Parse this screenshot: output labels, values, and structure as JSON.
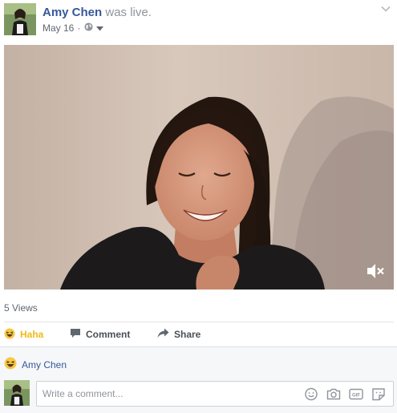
{
  "post": {
    "author": "Amy Chen",
    "action": "was live.",
    "date": "May 16",
    "separator": "·",
    "privacy_icon": "globe-icon",
    "menu_icon": "chevron-down-icon"
  },
  "video": {
    "mute_icon": "speaker-muted-icon"
  },
  "stats": {
    "views": "5 Views"
  },
  "actions": {
    "reaction_label": "Haha",
    "reaction_icon": "haha-emoji-icon",
    "comment_label": "Comment",
    "share_label": "Share"
  },
  "reactions": {
    "icon": "haha-emoji-icon",
    "names": "Amy Chen"
  },
  "comment_box": {
    "placeholder": "Write a comment...",
    "buttons": [
      "emoji-icon",
      "camera-icon",
      "gif-icon",
      "sticker-icon"
    ]
  },
  "colors": {
    "link": "#365899",
    "haha": "#f0ba15",
    "muted_text": "#90949c",
    "footer_bg": "#f6f7f9"
  }
}
